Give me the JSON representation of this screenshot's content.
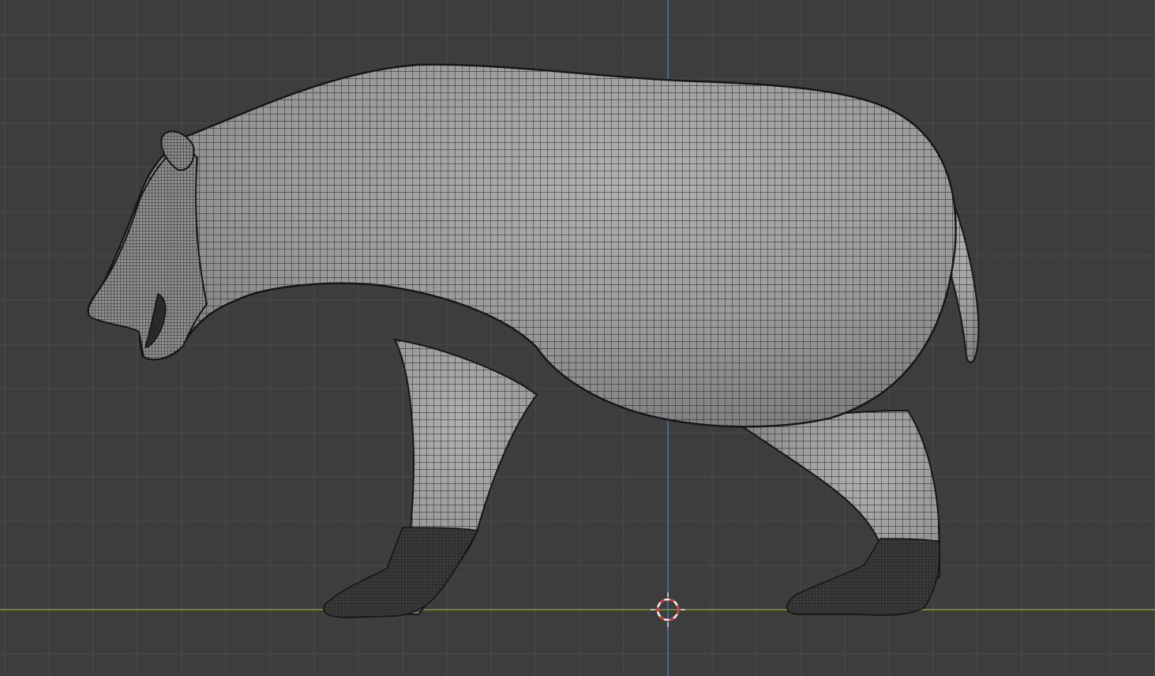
{
  "viewport": {
    "view": "orthographic-side",
    "shading": "solid-wireframe-overlay",
    "background_color": "#3d3d3d",
    "grid_line_color": "#4a4a4a",
    "grid_sub_line_color": "#424242",
    "x_axis_color": "#7c9b35",
    "z_axis_color": "#4c7ab8"
  },
  "mesh": {
    "object": "bear",
    "icon": "mesh-icon",
    "surface_color": "#9a9a9a",
    "wire_color": "#1e1e1e",
    "claw_color": "#2a2a2a"
  },
  "cursor": {
    "icon": "3d-cursor-icon",
    "ring_color_a": "#e03a3a",
    "ring_color_b": "#f2f2f2"
  }
}
